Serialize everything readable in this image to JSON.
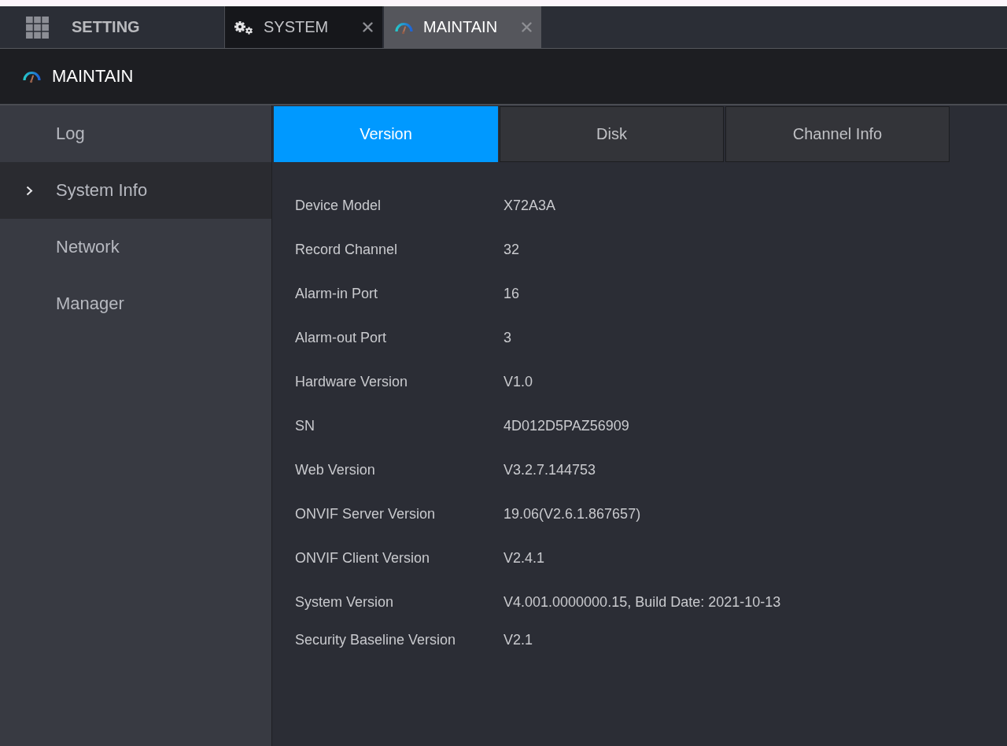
{
  "top_bar": {
    "title": "SETTING",
    "tabs": [
      {
        "kind": "system",
        "label": "SYSTEM",
        "selected": false
      },
      {
        "kind": "maintain",
        "label": "MAINTAIN",
        "selected": true
      }
    ]
  },
  "header": {
    "title": "MAINTAIN"
  },
  "sidebar": {
    "items": [
      {
        "label": "Log",
        "selected": false
      },
      {
        "label": "System Info",
        "selected": true
      },
      {
        "label": "Network",
        "selected": false
      },
      {
        "label": "Manager",
        "selected": false
      }
    ]
  },
  "content": {
    "tabs": [
      {
        "label": "Version",
        "selected": true
      },
      {
        "label": "Disk",
        "selected": false
      },
      {
        "label": "Channel Info",
        "selected": false
      }
    ],
    "rows": [
      {
        "label": "Device Model",
        "value": "X72A3A"
      },
      {
        "label": "Record Channel",
        "value": "32"
      },
      {
        "label": "Alarm-in Port",
        "value": "16"
      },
      {
        "label": "Alarm-out Port",
        "value": "3"
      },
      {
        "label": "Hardware Version",
        "value": "V1.0"
      },
      {
        "label": "SN",
        "value": "4D012D5PAZ56909"
      },
      {
        "label": "Web Version",
        "value": "V3.2.7.144753"
      },
      {
        "label": "ONVIF Server Version",
        "value": "19.06(V2.6.1.867657)"
      },
      {
        "label": "ONVIF Client Version",
        "value": "V2.4.1"
      },
      {
        "label": "System Version",
        "value": "V4.001.0000000.15, Build Date: 2021-10-13"
      },
      {
        "label": "Security Baseline Version",
        "value": "V2.1"
      }
    ]
  }
}
